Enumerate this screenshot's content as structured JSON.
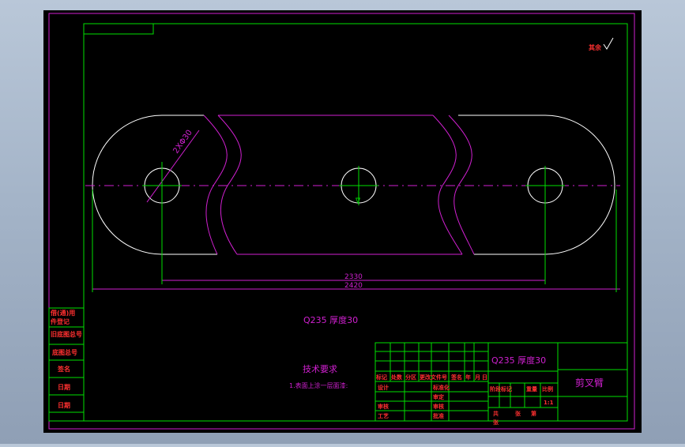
{
  "drawing": {
    "dim_inner": "2330",
    "dim_outer": "2420",
    "hole_callout": "2XΦ30",
    "roughness_symbol": "其余",
    "material_label": "Q235 厚度30",
    "tech_title": "技术要求",
    "tech_item": "1.表面上涂一层面漆:"
  },
  "side_labels": [
    "借(通)用",
    "件登记",
    "旧底图总号",
    "底图总号",
    "签名",
    "日期",
    "日期"
  ],
  "title_block": {
    "material": "Q235 厚度30",
    "part_name": "剪叉臂",
    "row_header": [
      "标记",
      "处数",
      "分区",
      "更改文件号",
      "签名",
      "年",
      "月",
      "日"
    ],
    "labels": {
      "design": "设计",
      "standardize": "标准化",
      "approve_count": "审核",
      "craft": "工艺",
      "check": "审核",
      "approve": "批准",
      "review": "审定",
      "stage": "阶段标记",
      "weight": "重量",
      "scale": "比例",
      "scale_value": "1:1",
      "total": "共",
      "sheet": "张",
      "page": "第",
      "sheet_no": "张"
    }
  }
}
